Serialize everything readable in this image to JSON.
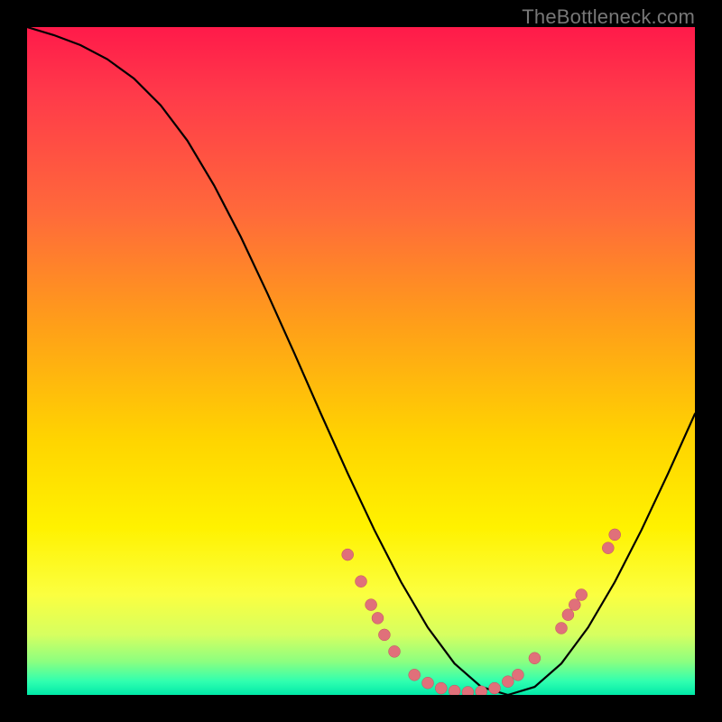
{
  "watermark": "TheBottleneck.com",
  "chart_data": {
    "type": "line",
    "title": "",
    "xlabel": "",
    "ylabel": "",
    "xlim": [
      0,
      100
    ],
    "ylim": [
      0,
      100
    ],
    "series": [
      {
        "name": "curve",
        "x": [
          0,
          4,
          8,
          12,
          16,
          20,
          24,
          28,
          32,
          36,
          40,
          44,
          48,
          52,
          56,
          60,
          64,
          68,
          72,
          76,
          80,
          84,
          88,
          92,
          96,
          100
        ],
        "y": [
          100,
          98.8,
          97.3,
          95.2,
          92.3,
          88.3,
          83.0,
          76.3,
          68.6,
          60.1,
          51.2,
          42.1,
          33.2,
          24.7,
          16.9,
          10.1,
          4.7,
          1.2,
          0.0,
          1.2,
          4.7,
          10.1,
          16.9,
          24.7,
          33.2,
          42.1
        ]
      }
    ],
    "highlight_band_y": [
      0,
      21
    ],
    "points": [
      {
        "x": 48.0,
        "y": 21.0
      },
      {
        "x": 50.0,
        "y": 17.0
      },
      {
        "x": 51.5,
        "y": 13.5
      },
      {
        "x": 52.5,
        "y": 11.5
      },
      {
        "x": 53.5,
        "y": 9.0
      },
      {
        "x": 55.0,
        "y": 6.5
      },
      {
        "x": 58.0,
        "y": 3.0
      },
      {
        "x": 60.0,
        "y": 1.8
      },
      {
        "x": 62.0,
        "y": 1.0
      },
      {
        "x": 64.0,
        "y": 0.6
      },
      {
        "x": 66.0,
        "y": 0.4
      },
      {
        "x": 68.0,
        "y": 0.5
      },
      {
        "x": 70.0,
        "y": 1.0
      },
      {
        "x": 72.0,
        "y": 2.0
      },
      {
        "x": 73.5,
        "y": 3.0
      },
      {
        "x": 76.0,
        "y": 5.5
      },
      {
        "x": 80.0,
        "y": 10.0
      },
      {
        "x": 81.0,
        "y": 12.0
      },
      {
        "x": 82.0,
        "y": 13.5
      },
      {
        "x": 83.0,
        "y": 15.0
      },
      {
        "x": 87.0,
        "y": 22.0
      },
      {
        "x": 88.0,
        "y": 24.0
      }
    ]
  }
}
